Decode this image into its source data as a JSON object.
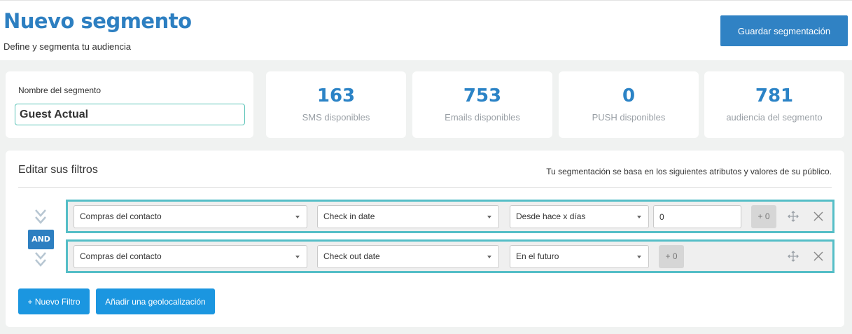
{
  "header": {
    "title": "Nuevo segmento",
    "subtitle": "Define y segmenta tu audiencia",
    "save_label": "Guardar segmentación"
  },
  "segment": {
    "name_label": "Nombre del segmento",
    "name_value": "Guest Actual"
  },
  "stats": [
    {
      "value": "163",
      "label": "SMS disponibles"
    },
    {
      "value": "753",
      "label": "Emails disponibles"
    },
    {
      "value": "0",
      "label": "PUSH disponibles"
    },
    {
      "value": "781",
      "label": "audiencia del segmento"
    }
  ],
  "filters": {
    "title": "Editar sus filtros",
    "hint": "Tu segmentación se basa en los siguientes atributos y valores de su público.",
    "connector": "AND",
    "rows": [
      {
        "category": "Compras del contacto",
        "attribute": "Check in date",
        "operator": "Desde hace x días",
        "value": "0",
        "plus_label": "+ 0"
      },
      {
        "category": "Compras del contacto",
        "attribute": "Check out date",
        "operator": "En el futuro",
        "plus_label": "+ 0"
      }
    ],
    "new_filter_label": "+ Nuevo Filtro",
    "add_geo_label": "Añadir una geolocalización"
  },
  "colors": {
    "accent": "#2d7fc1",
    "button": "#1b96e0",
    "row_border": "#55bec7",
    "stat_value": "#2b83c6"
  },
  "icons": [
    "move-icon",
    "close-icon",
    "chevron-down-icon",
    "caret-down-icon"
  ]
}
